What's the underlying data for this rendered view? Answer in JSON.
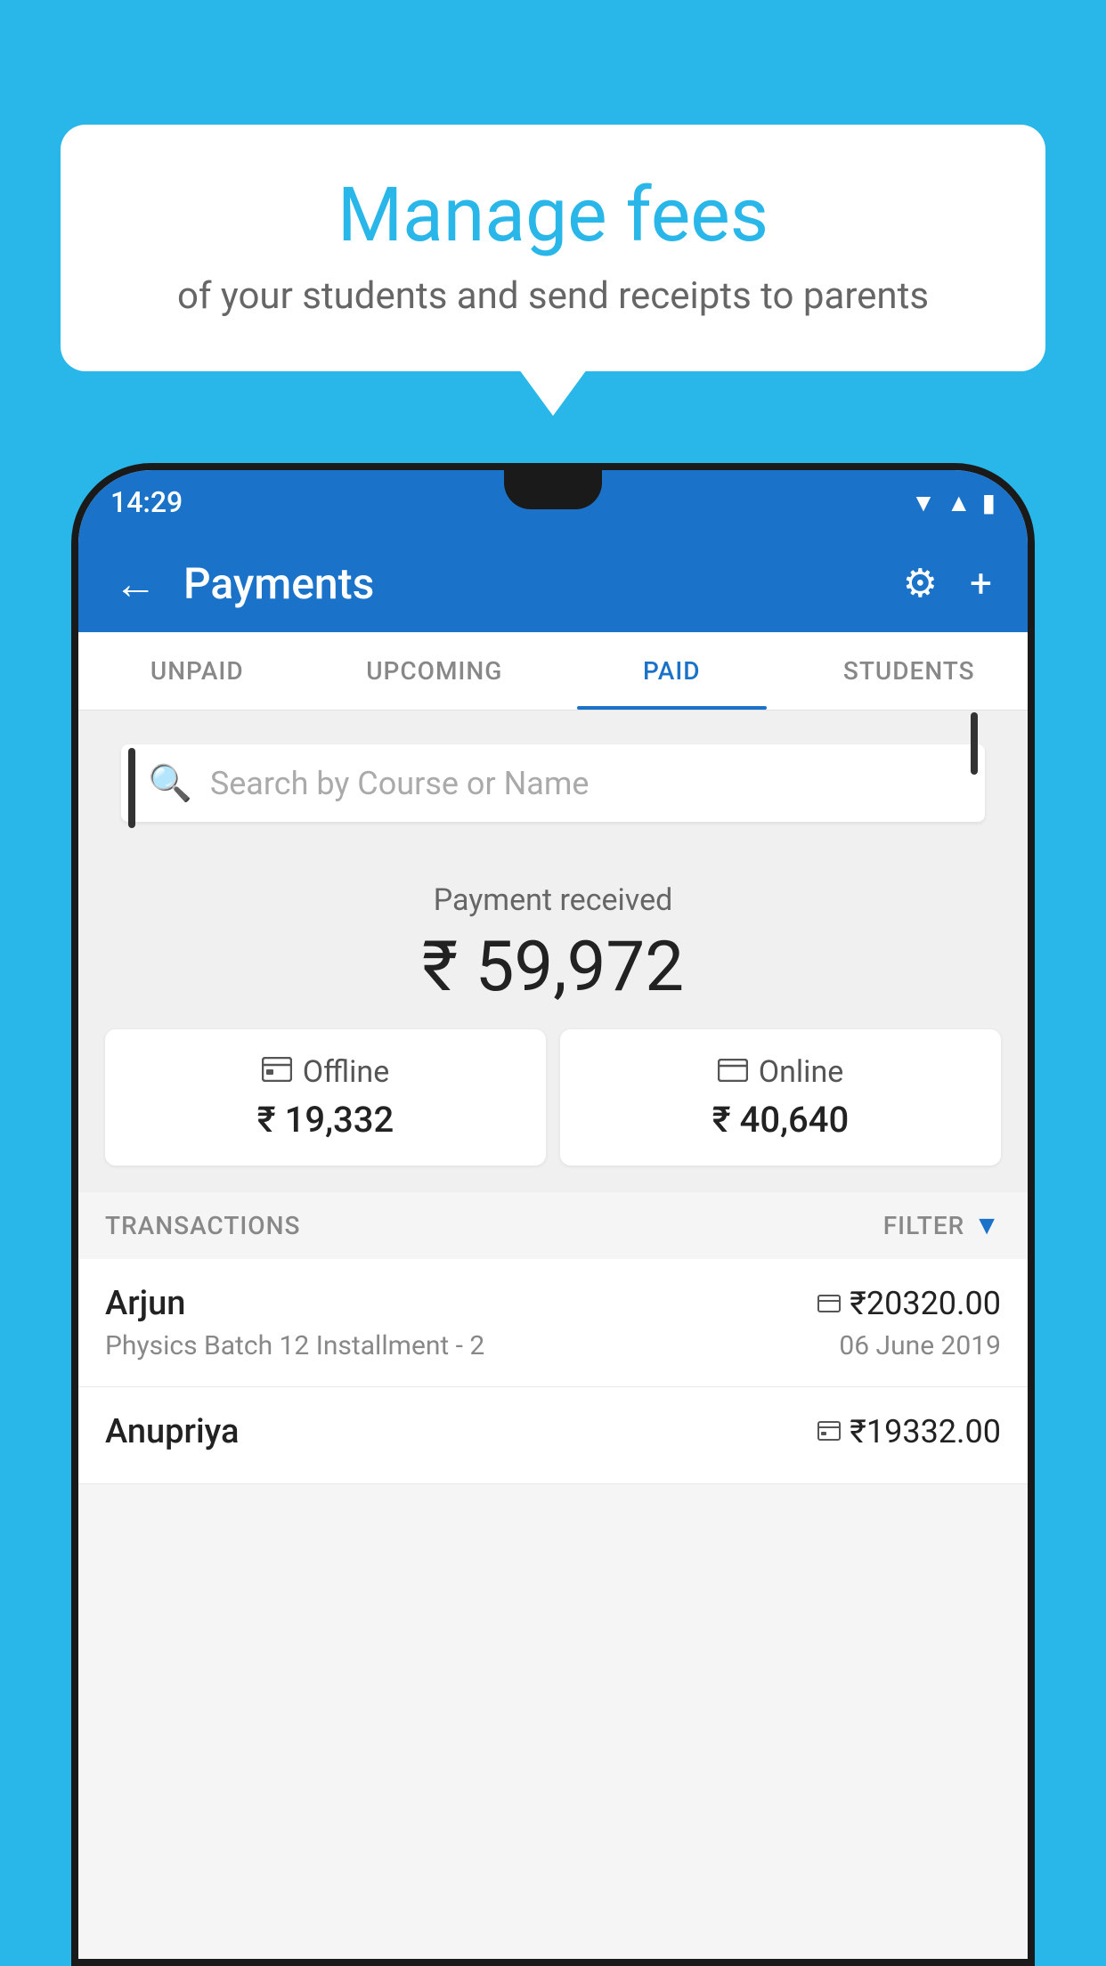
{
  "background_color": "#29B6E8",
  "speech_bubble": {
    "title": "Manage fees",
    "subtitle": "of your students and send receipts to parents"
  },
  "status_bar": {
    "time": "14:29"
  },
  "app_bar": {
    "title": "Payments",
    "back_label": "←",
    "gear_label": "⚙",
    "plus_label": "+"
  },
  "tabs": [
    {
      "label": "UNPAID",
      "active": false
    },
    {
      "label": "UPCOMING",
      "active": false
    },
    {
      "label": "PAID",
      "active": true
    },
    {
      "label": "STUDENTS",
      "active": false
    }
  ],
  "search": {
    "placeholder": "Search by Course or Name"
  },
  "payment_summary": {
    "label": "Payment received",
    "amount": "₹ 59,972",
    "offline": {
      "icon": "💳",
      "label": "Offline",
      "amount": "₹ 19,332"
    },
    "online": {
      "icon": "💳",
      "label": "Online",
      "amount": "₹ 40,640"
    }
  },
  "transactions": {
    "label": "TRANSACTIONS",
    "filter_label": "FILTER",
    "rows": [
      {
        "name": "Arjun",
        "amount": "₹20320.00",
        "course": "Physics Batch 12 Installment - 2",
        "date": "06 June 2019",
        "payment_type": "online"
      },
      {
        "name": "Anupriya",
        "amount": "₹19332.00",
        "course": "",
        "date": "",
        "payment_type": "offline"
      }
    ]
  }
}
